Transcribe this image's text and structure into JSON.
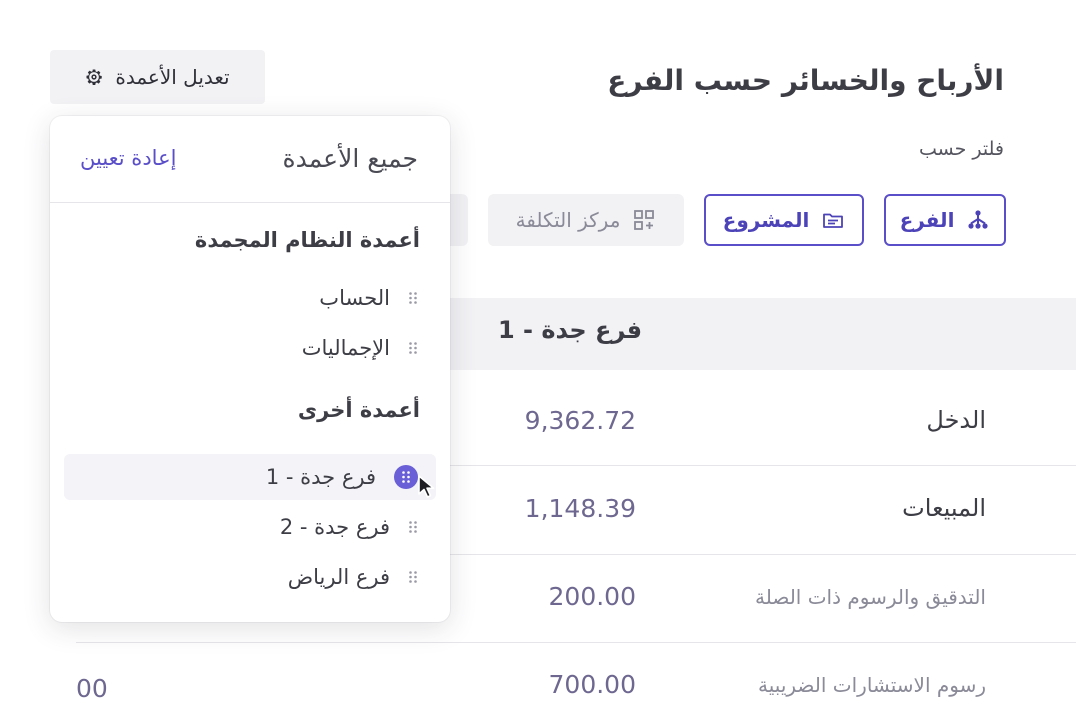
{
  "header": {
    "title": "الأرباح والخسائر حسب الفرع",
    "filter_label": "فلتر حسب",
    "edit_columns_label": "تعديل الأعمدة"
  },
  "filters": {
    "branch": "الفرع",
    "project": "المشروع",
    "cost_center": "مركز التكلفة"
  },
  "table": {
    "column_header": "فرع جدة - 1",
    "rows": [
      {
        "label": "الدخل",
        "value": "9,362.72"
      },
      {
        "label": "المبيعات",
        "value": "1,148.39"
      },
      {
        "label": "التدقيق والرسوم ذات الصلة",
        "value": "200.00"
      },
      {
        "label": "رسوم الاستشارات الضريبية",
        "value": "700.00"
      }
    ],
    "partial_value": "00"
  },
  "columns_panel": {
    "title": "جميع الأعمدة",
    "reset_label": "إعادة تعيين",
    "frozen_section_title": "أعمدة النظام المجمدة",
    "frozen_items": [
      "الحساب",
      "الإجماليات"
    ],
    "other_section_title": "أعمدة أخرى",
    "other_items": [
      "فرع جدة - 1",
      "فرع جدة - 2",
      "فرع الرياض"
    ]
  },
  "colors": {
    "accent": "#5a4fc8",
    "value_text": "#6e6890",
    "header_bg": "#f2f2f5"
  }
}
